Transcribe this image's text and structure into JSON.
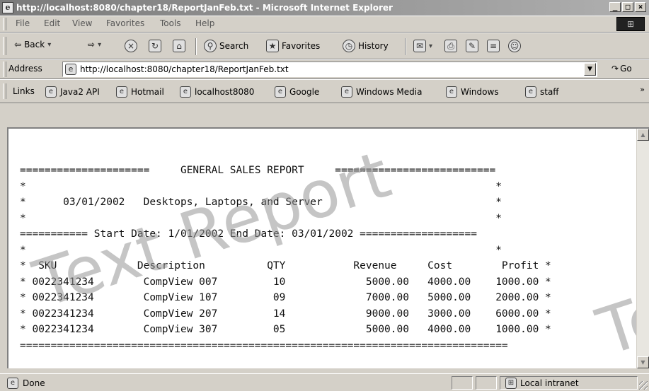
{
  "window": {
    "title": "http://localhost:8080/chapter18/ReportJanFeb.txt - Microsoft Internet Explorer",
    "buttons": {
      "minimize": "_",
      "maximize": "□",
      "close": "×"
    }
  },
  "menu": [
    "File",
    "Edit",
    "View",
    "Favorites",
    "Tools",
    "Help"
  ],
  "toolbar": {
    "back": "Back",
    "search": "Search",
    "favorites": "Favorites",
    "history": "History"
  },
  "address": {
    "label": "Address",
    "url": "http://localhost:8080/chapter18/ReportJanFeb.txt",
    "go": "Go"
  },
  "links": {
    "label": "Links",
    "items": [
      "Java2 API",
      "Hotmail",
      "localhost8080",
      "Google",
      "Windows Media",
      "Windows",
      "staff"
    ],
    "more": "»"
  },
  "report": {
    "lines": [
      "=====================     GENERAL SALES REPORT     ==========================",
      "*                                                                            *",
      "*      03/01/2002   Desktops, Laptops, and Server                            *",
      "*                                                                            *",
      "=========== Start Date: 1/01/2002 End Date: 03/01/2002 ===================",
      "*                                                                            *",
      "*  SKU             Description          QTY           Revenue     Cost        Profit *",
      "* 0022341234        CompView 007         10             5000.00   4000.00    1000.00 *",
      "* 0022341234        CompView 107         09             7000.00   5000.00    2000.00 *",
      "* 0022341234        CompView 207         14             9000.00   3000.00    6000.00 *",
      "* 0022341234        CompView 307         05             5000.00   4000.00    1000.00 *",
      "==============================================================================="
    ],
    "watermark": "Text Report",
    "watermark_right": "Te"
  },
  "status": {
    "text": "Done",
    "zone": "Local intranet"
  }
}
